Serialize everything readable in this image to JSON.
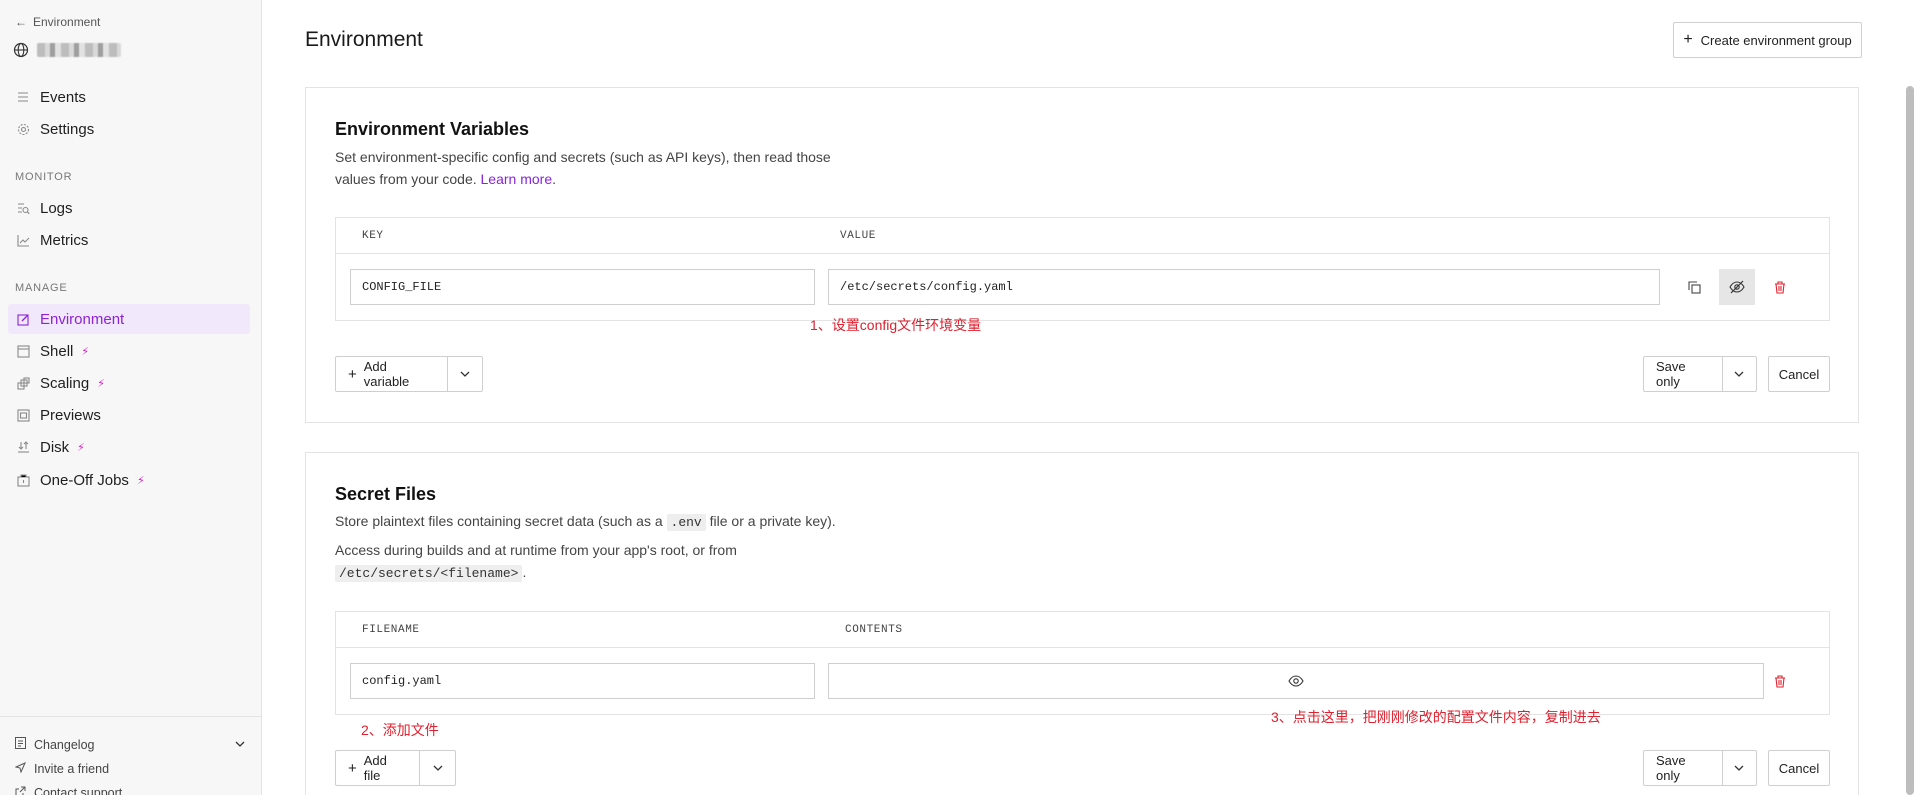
{
  "sidebar": {
    "back_label": "Environment",
    "monitor_label": "MONITOR",
    "manage_label": "MANAGE",
    "items_top": [
      {
        "label": "Events",
        "icon": "list-icon"
      },
      {
        "label": "Settings",
        "icon": "gear-icon"
      }
    ],
    "monitor_items": [
      {
        "label": "Logs",
        "icon": "logs-icon"
      },
      {
        "label": "Metrics",
        "icon": "chart-icon"
      }
    ],
    "manage_items": [
      {
        "label": "Environment",
        "icon": "edit-icon",
        "active": true
      },
      {
        "label": "Shell",
        "icon": "terminal-icon",
        "badge": "bolt"
      },
      {
        "label": "Scaling",
        "icon": "scaling-icon",
        "badge": "bolt"
      },
      {
        "label": "Previews",
        "icon": "previews-icon"
      },
      {
        "label": "Disk",
        "icon": "disk-icon",
        "badge": "bolt"
      },
      {
        "label": "One-Off Jobs",
        "icon": "jobs-icon",
        "badge": "bolt"
      }
    ],
    "footer": {
      "changelog": "Changelog",
      "invite": "Invite a friend",
      "contact": "Contact support"
    }
  },
  "header": {
    "title": "Environment",
    "create_group_label": "Create environment group"
  },
  "env_vars": {
    "title": "Environment Variables",
    "desc_line1": "Set environment-specific config and secrets (such as API keys), then read those",
    "desc_line2": "values from your code.",
    "learn_more": "Learn more",
    "col_key": "KEY",
    "col_value": "VALUE",
    "row": {
      "key": "CONFIG_FILE",
      "value": "/etc/secrets/config.yaml"
    },
    "add_label": "Add variable",
    "save_label": "Save only",
    "cancel_label": "Cancel",
    "annotation": "1、设置config文件环境变量"
  },
  "secret_files": {
    "title": "Secret Files",
    "desc_line1_a": "Store plaintext files containing secret data (such as a",
    "desc_line1_code": ".env",
    "desc_line1_b": "file or a private key).",
    "desc_line2": "Access during builds and at runtime from your app's root, or from",
    "desc_path": "/etc/secrets/<filename>",
    "col_filename": "FILENAME",
    "col_contents": "CONTENTS",
    "row": {
      "filename": "config.yaml"
    },
    "add_label": "Add file",
    "save_label": "Save only",
    "cancel_label": "Cancel",
    "annotation_add": "2、添加文件",
    "annotation_contents": "3、点击这里，把刚刚修改的配置文件内容，复制进去"
  },
  "colors": {
    "accent": "#8b24d6",
    "annotation": "#e0202e",
    "bolt": "#d31ec4"
  }
}
